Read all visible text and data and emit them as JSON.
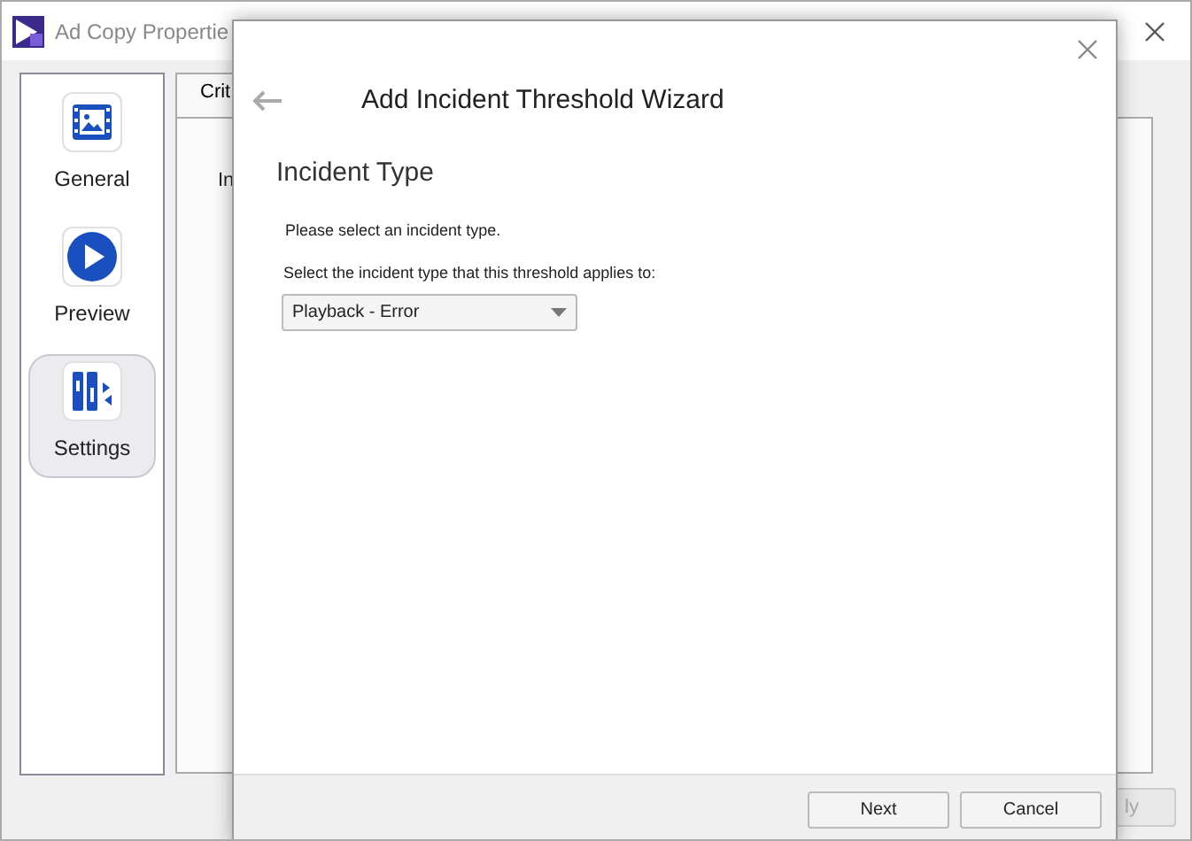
{
  "window": {
    "title": "Ad Copy Propertie"
  },
  "sidebar": {
    "items": [
      {
        "label": "General",
        "selected": false
      },
      {
        "label": "Preview",
        "selected": false
      },
      {
        "label": "Settings",
        "selected": true
      }
    ]
  },
  "tab": {
    "label": "Crit"
  },
  "field_label": "In",
  "apply_button": "ly",
  "dialog": {
    "title": "Add Incident Threshold Wizard",
    "heading": "Incident Type",
    "intro": "Please select an incident type.",
    "prompt": "Select the incident type that this threshold applies to:",
    "incident_type": {
      "value": "Playback - Error"
    },
    "buttons": [
      "Next",
      "Cancel"
    ]
  }
}
